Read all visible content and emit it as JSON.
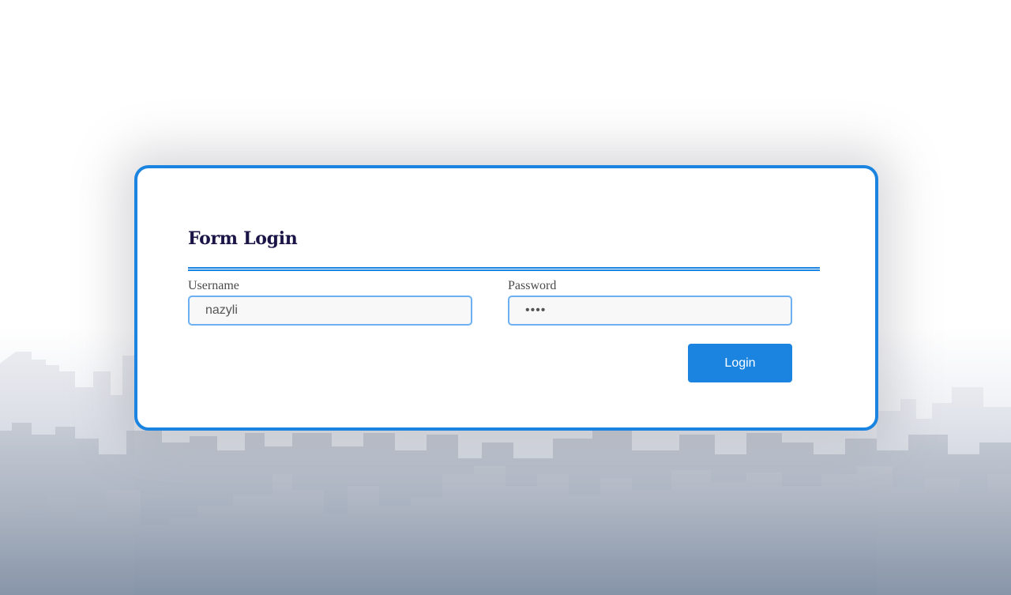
{
  "form": {
    "title": "Form Login",
    "username": {
      "label": "Username",
      "value": "nazyli"
    },
    "password": {
      "label": "Password",
      "value": "••••"
    },
    "login_label": "Login"
  },
  "colors": {
    "accent": "#1a84e0",
    "title": "#1a1447",
    "input_border": "#6cb0f2",
    "skyline": "#a3adbd"
  }
}
